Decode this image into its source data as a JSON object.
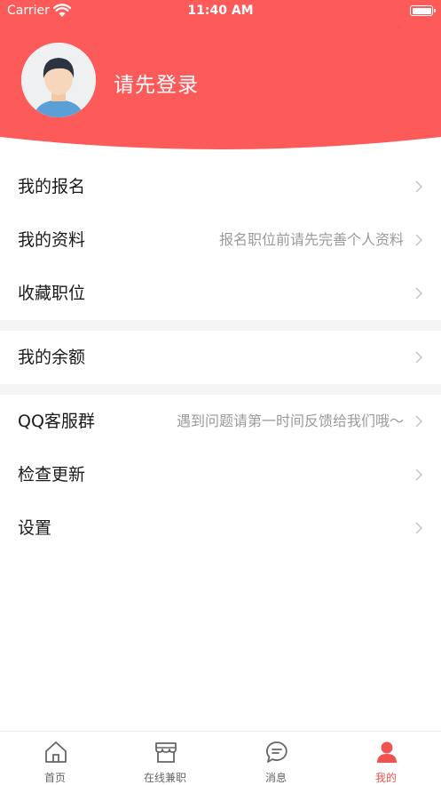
{
  "status_bar": {
    "carrier": "Carrier",
    "time": "11:40 AM"
  },
  "header": {
    "login_prompt": "请先登录",
    "background_color": "#fd5a5a"
  },
  "menu": {
    "my_signups": {
      "label": "我的报名",
      "hint": ""
    },
    "my_profile": {
      "label": "我的资料",
      "hint": "报名职位前请先完善个人资料"
    },
    "saved_jobs": {
      "label": "收藏职位",
      "hint": ""
    },
    "my_balance": {
      "label": "我的余额",
      "hint": ""
    },
    "qq_group": {
      "label": "QQ客服群",
      "hint": "遇到问题请第一时间反馈给我们哦～"
    },
    "check_update": {
      "label": "检查更新",
      "hint": ""
    },
    "settings": {
      "label": "设置",
      "hint": ""
    }
  },
  "tab_bar": {
    "tabs": [
      {
        "label": "首页",
        "icon": "home-icon"
      },
      {
        "label": "在线兼职",
        "icon": "store-icon"
      },
      {
        "label": "消息",
        "icon": "chat-icon"
      },
      {
        "label": "我的",
        "icon": "person-icon"
      }
    ],
    "active_index": 3,
    "active_color": "#f0524f"
  }
}
